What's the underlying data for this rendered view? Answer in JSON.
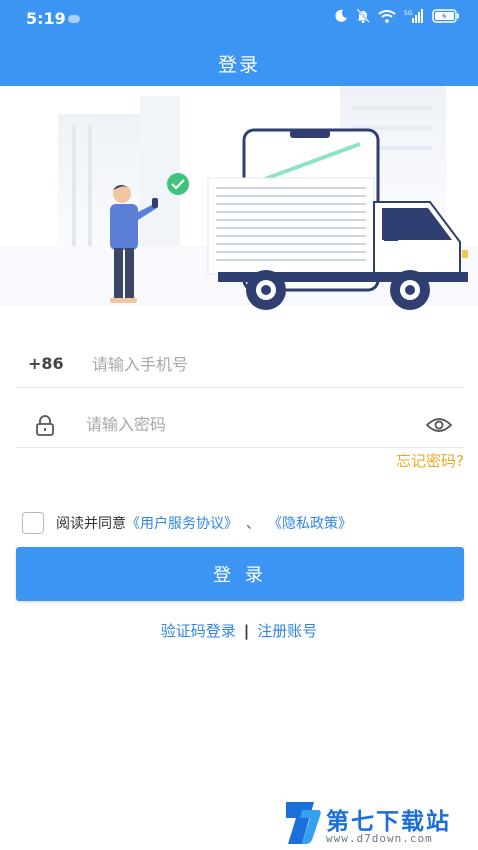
{
  "status_bar": {
    "time": "5:19",
    "icons": [
      "moon-icon",
      "bell-off-icon",
      "wifi-icon",
      "signal-icon",
      "battery-charging-icon"
    ]
  },
  "header": {
    "title": "登录"
  },
  "login_form": {
    "phone": {
      "prefix": "+86",
      "placeholder": "请输入手机号",
      "value": ""
    },
    "password": {
      "placeholder": "请输入密码",
      "value": ""
    },
    "forgot_password": "忘记密码?",
    "agreement": {
      "checked": false,
      "prefix": "阅读并同意",
      "user_agreement": "《用户服务协议》",
      "separator": "、",
      "privacy_policy": "《隐私政策》"
    },
    "submit_label": "登 录"
  },
  "bottom_links": {
    "code_login": "验证码登录",
    "divider": "|",
    "register": "注册账号"
  },
  "watermark": {
    "title": "第七下载站",
    "url": "www.d7down.com"
  },
  "colors": {
    "brand_blue": "#3d95f3",
    "link_blue": "#2f86e8",
    "accent_orange": "#f5a623",
    "truck_navy": "#2f3f72",
    "check_green": "#3fc37c"
  }
}
